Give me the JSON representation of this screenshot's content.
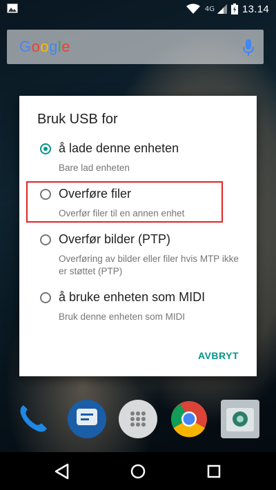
{
  "status_bar": {
    "network": "4G",
    "time": "13.14",
    "icons": [
      "image-icon",
      "wifi-icon",
      "signal-icon",
      "battery-icon"
    ]
  },
  "search_bar": {
    "logo": "Google",
    "icons": [
      "mic-icon"
    ]
  },
  "dialog": {
    "title": "Bruk USB for",
    "options": [
      {
        "label": "å lade denne enheten",
        "description": "Bare lad enheten",
        "selected": true
      },
      {
        "label": "Overføre filer",
        "description": "Overfør filer til en annen enhet",
        "selected": false,
        "highlighted": true
      },
      {
        "label": "Overfør bilder (PTP)",
        "description": "Overføring av bilder eller filer hvis MTP ikke er støttet (PTP)",
        "selected": false
      },
      {
        "label": "å bruke enheten som MIDI",
        "description": "Bruk denne enheten som MIDI",
        "selected": false
      }
    ],
    "cancel_label": "AVBRYT"
  },
  "dock": {
    "apps": [
      "phone-icon",
      "messages-icon",
      "app-drawer-icon",
      "chrome-icon",
      "camera-icon"
    ]
  },
  "nav_bar": {
    "buttons": [
      "back-icon",
      "home-icon",
      "recents-icon"
    ]
  },
  "colors": {
    "accent": "#009688",
    "highlight_border": "#e02424"
  }
}
